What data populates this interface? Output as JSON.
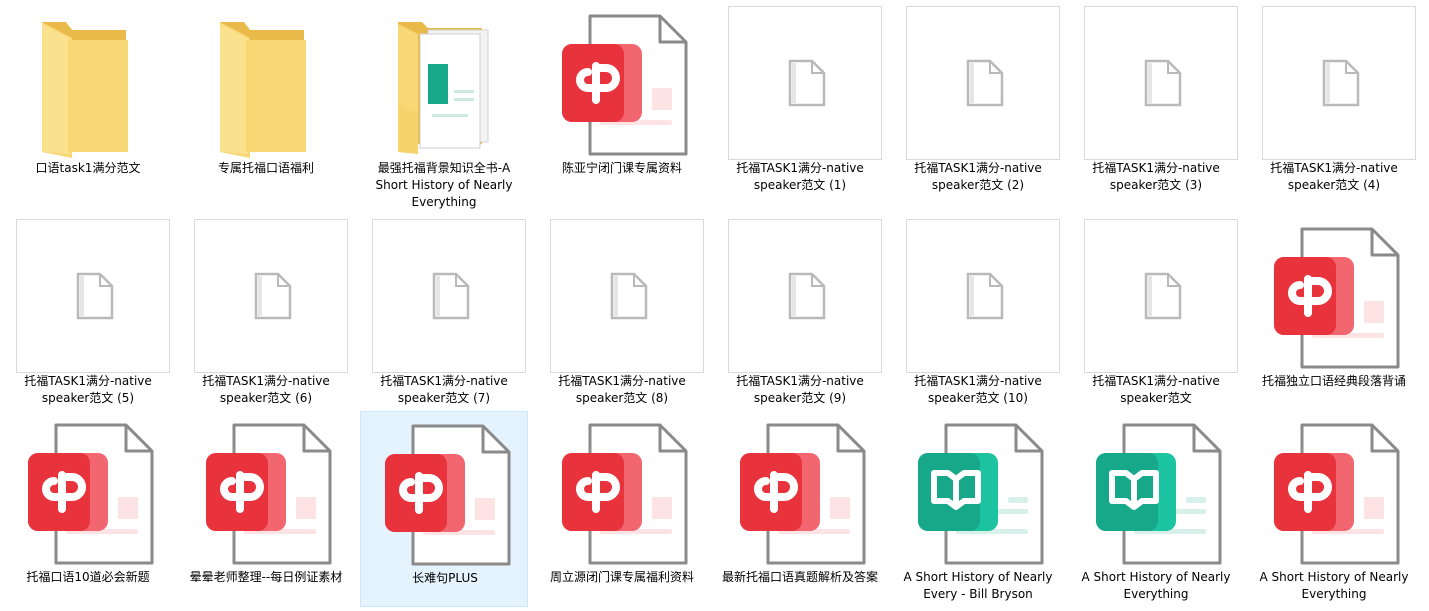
{
  "files": [
    {
      "name": "口语task1满分范文",
      "icon": "folder-icon"
    },
    {
      "name": "专属托福口语福利",
      "icon": "folder-icon"
    },
    {
      "name": "最强托福背景知识全书-A Short History of Nearly Everything",
      "icon": "folder-with-documents-icon"
    },
    {
      "name": "陈亚宁闭门课专属资料",
      "icon": "pdf-reader-file-icon"
    },
    {
      "name": "托福TASK1满分-native speaker范文 (1)",
      "icon": "blank-file-icon"
    },
    {
      "name": "托福TASK1满分-native speaker范文 (2)",
      "icon": "blank-file-icon"
    },
    {
      "name": "托福TASK1满分-native speaker范文 (3)",
      "icon": "blank-file-icon"
    },
    {
      "name": "托福TASK1满分-native speaker范文 (4)",
      "icon": "blank-file-icon"
    },
    {
      "name": "托福TASK1满分-native speaker范文 (5)",
      "icon": "blank-file-icon"
    },
    {
      "name": "托福TASK1满分-native speaker范文 (6)",
      "icon": "blank-file-icon"
    },
    {
      "name": "托福TASK1满分-native speaker范文 (7)",
      "icon": "blank-file-icon"
    },
    {
      "name": "托福TASK1满分-native speaker范文 (8)",
      "icon": "blank-file-icon"
    },
    {
      "name": "托福TASK1满分-native speaker范文 (9)",
      "icon": "blank-file-icon"
    },
    {
      "name": "托福TASK1满分-native speaker范文 (10)",
      "icon": "blank-file-icon"
    },
    {
      "name": "托福TASK1满分-native speaker范文",
      "icon": "blank-file-icon"
    },
    {
      "name": "托福独立口语经典段落背诵",
      "icon": "pdf-reader-file-icon"
    },
    {
      "name": "托福口语10道必会新题",
      "icon": "pdf-reader-file-icon"
    },
    {
      "name": "晕晕老师整理--每日例证素材",
      "icon": "pdf-reader-file-icon"
    },
    {
      "name": "长难句PLUS",
      "icon": "pdf-reader-file-icon",
      "selected": true
    },
    {
      "name": "周立源闭门课专属福利资料",
      "icon": "pdf-reader-file-icon"
    },
    {
      "name": "最新托福口语真题解析及答案",
      "icon": "pdf-reader-file-icon"
    },
    {
      "name": "A Short History of Nearly Every - Bill Bryson",
      "icon": "ebook-file-icon"
    },
    {
      "name": "A Short History of Nearly Everything",
      "icon": "ebook-file-icon"
    },
    {
      "name": "A Short History of Nearly Everything",
      "icon": "pdf-reader-file-icon"
    }
  ],
  "colors": {
    "folder": "#f8d775",
    "pdf_red": "#e8323c",
    "ebook_teal": "#16a889",
    "selection": "#e5f3ff"
  }
}
